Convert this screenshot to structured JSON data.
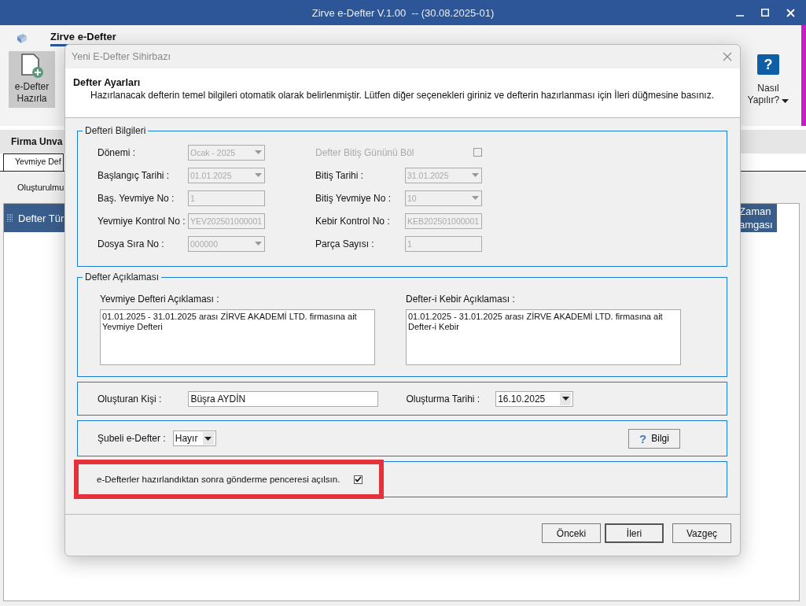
{
  "app": {
    "title": "Zirve e-Defter V.1.00  -- (30.08.2025-01)",
    "ribbon_tab": "Zirve e-Defter",
    "ribbon_buttons": [
      {
        "label": "e-Defter Hazırla",
        "selected": true
      }
    ],
    "help_icon": "?",
    "help_button": "Nasıl Yapılır?",
    "firma_header": "Firma Unva",
    "tabs": [
      {
        "label": "Yevmiye Def",
        "selected": true
      }
    ],
    "sub_label": "Oluşturulmu",
    "table": {
      "columns": [
        "Defter Tür",
        "Zaman amgası"
      ]
    }
  },
  "dialog": {
    "title": "Yeni E-Defter Sihirbazı",
    "heading": "Defter Ayarları",
    "description": "Hazırlanacak defterin temel bilgileri otomatik olarak belirlenmiştir. Lütfen diğer seçenekleri giriniz ve defterin hazırlanması için İleri düğmesine basınız.",
    "defteri_bilgileri": {
      "legend": "Defteri Bilgileri",
      "rows": [
        {
          "left": {
            "label": "Dönemi :",
            "kind": "dropdown",
            "value": "Ocak - 2025",
            "disabled": true
          },
          "right": {
            "label": "Defter Bitiş Gününü Böl",
            "kind": "checkbox",
            "checked": false,
            "disabled": true
          }
        },
        {
          "left": {
            "label": "Başlangıç Tarihi :",
            "kind": "dropdown",
            "value": "01.01.2025",
            "disabled": true
          },
          "right": {
            "label": "Bitiş Tarihi :",
            "kind": "dropdown",
            "value": "31.01.2025",
            "disabled": true
          }
        },
        {
          "left": {
            "label": "Baş. Yevmiye No :",
            "kind": "text",
            "value": "1",
            "disabled": true
          },
          "right": {
            "label": "Bitiş Yevmiye No :",
            "kind": "dropdown",
            "value": "10",
            "disabled": true
          }
        },
        {
          "left": {
            "label": "Yevmiye Kontrol No :",
            "kind": "text",
            "value": "YEV202501000001",
            "disabled": true
          },
          "right": {
            "label": "Kebir Kontrol No :",
            "kind": "text",
            "value": "KEB202501000001",
            "disabled": true
          }
        },
        {
          "left": {
            "label": "Dosya Sıra No :",
            "kind": "dropdown",
            "value": "000000",
            "disabled": true
          },
          "right": {
            "label": "Parça Sayısı :",
            "kind": "text",
            "value": "1",
            "disabled": true
          }
        }
      ]
    },
    "defter_aciklamasi": {
      "legend": "Defter Açıklaması",
      "items": [
        {
          "label": "Yevmiye Defteri Açıklaması :",
          "value": "01.01.2025 - 31.01.2025 arası ZİRVE AKADEMİ LTD. firmasına ait\nYevmiye Defteri"
        },
        {
          "label": "Defter-i Kebir Açıklaması :",
          "value": "01.01.2025 - 31.01.2025 arası ZİRVE AKADEMİ LTD. firmasına ait\nDefter-i Kebir"
        }
      ]
    },
    "olusturan": {
      "label": "Oluşturan Kişi :",
      "value": "Büşra AYDİN"
    },
    "olusturma_tarihi": {
      "label": "Oluşturma Tarihi :",
      "value": "16.10.2025"
    },
    "subeli": {
      "label": "Şubeli e-Defter :",
      "value": "Hayır"
    },
    "info_icon": "?",
    "info_button": "Bilgi",
    "send_option": {
      "label": "e-Defterler hazırlandıktan sonra gönderme penceresi açılsın.",
      "checked": true,
      "highlighted": true
    },
    "buttons": [
      {
        "label": "Önceki",
        "default": false
      },
      {
        "label": "İleri",
        "default": true
      },
      {
        "label": "Vazgeç",
        "default": false
      }
    ]
  }
}
